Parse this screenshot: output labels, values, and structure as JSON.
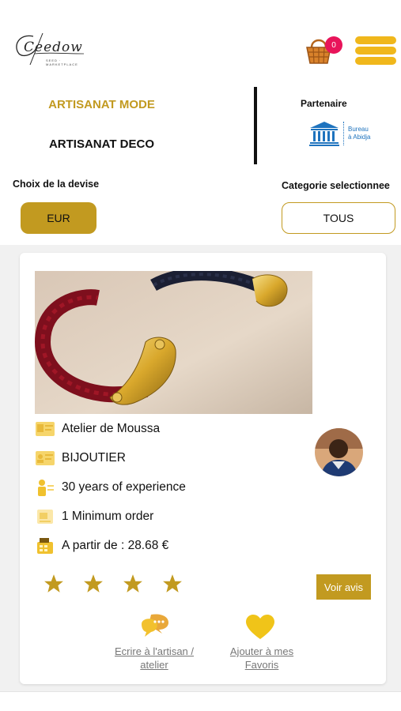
{
  "header": {
    "logo_text": "Ceedow",
    "logo_subtitle": "SEED · MARKETPLACE",
    "cart_count": "0",
    "icons": {
      "cart": "basket-icon",
      "menu": "hamburger-menu-icon"
    }
  },
  "categories": {
    "mode_label": "ARTISANAT MODE",
    "deco_label": "ARTISANAT DECO",
    "partner_label": "Partenaire",
    "partner_logo_line1": "Bureau",
    "partner_logo_line2": "à Abidja"
  },
  "filters": {
    "currency_label": "Choix de la devise",
    "currency_value": "EUR",
    "category_label": "Categorie selectionnee",
    "category_value": "TOUS"
  },
  "card": {
    "workshop": "Atelier de Moussa",
    "trade": "BIJOUTIER",
    "experience": "30 years of experience",
    "min_order": "1 Minimum order",
    "price": "A partir de : 28.68 €",
    "rating": 4,
    "rating_max": 4,
    "reviews_button": "Voir avis",
    "write_line1": "Ecrire à l'artisan /",
    "write_line2": "atelier",
    "fav_line1": "Ajouter à mes",
    "fav_line2": "Favoris"
  },
  "colors": {
    "accent": "#c29a20",
    "badge": "#e8145a",
    "heart": "#f0c419",
    "unesco_blue": "#1e73be"
  }
}
